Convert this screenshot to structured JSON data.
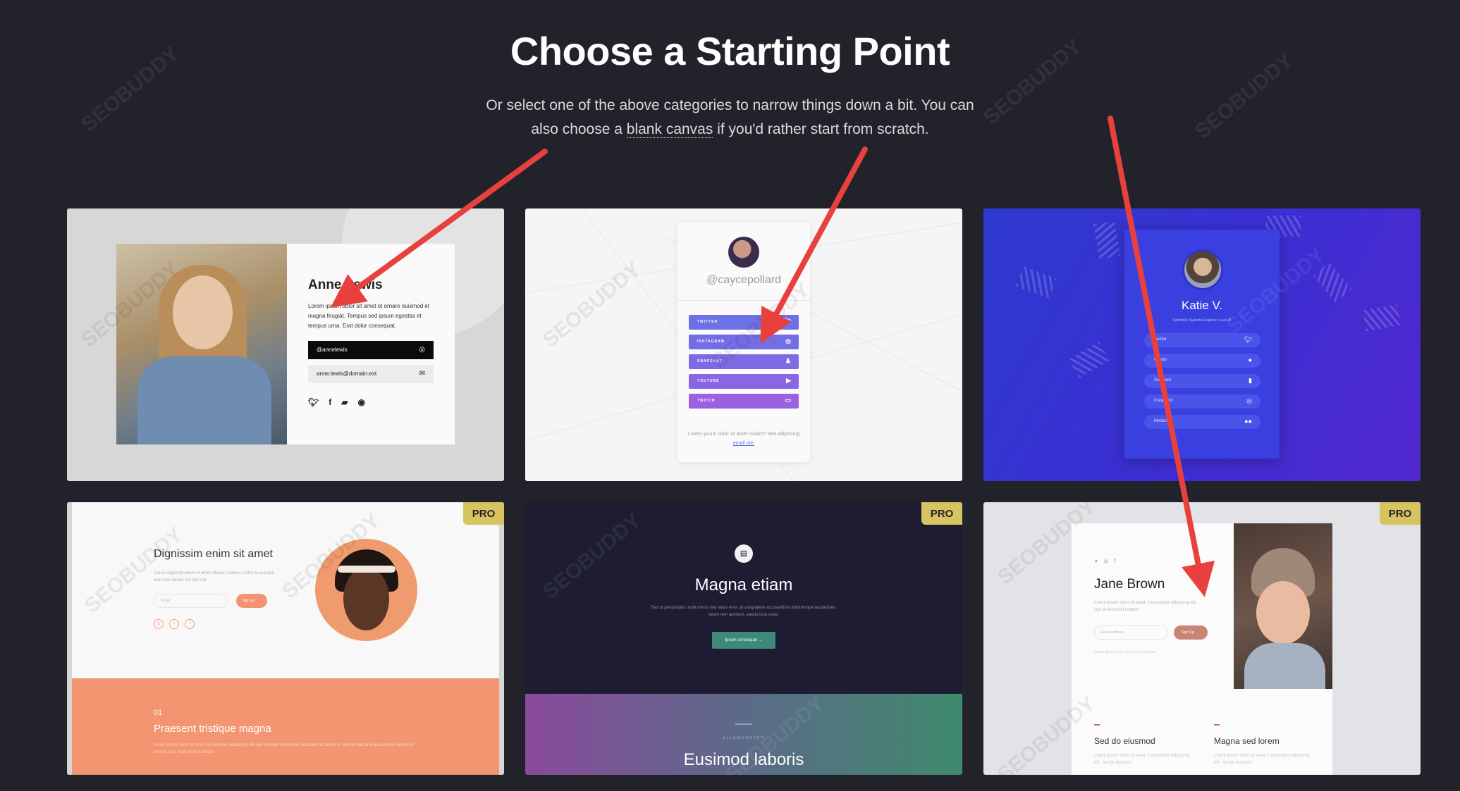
{
  "header": {
    "title": "Choose a Starting Point",
    "subtitle_line1": "Or select one of the above categories to narrow things down a bit. You can",
    "subtitle_line2_pre": "also choose a ",
    "subtitle_link": "blank canvas",
    "subtitle_line2_post": " if you'd rather start from scratch."
  },
  "cards": {
    "anne": {
      "name": "Anne Lewis",
      "desc": "Lorem ipsum dolor sit amet et ornare euismod et magna feugiat. Tempus sed ipsum egestas et tempus urna. Erat dolor consequat.",
      "handle": "@annelewis",
      "email": "anne.lewis@domain.ext"
    },
    "caycepollard": {
      "handle": "@caycepollard",
      "buttons": [
        {
          "label": "TWITTER",
          "icon": "twitter-icon",
          "color": "#6d70e6"
        },
        {
          "label": "INSTAGRAM",
          "icon": "instagram-icon",
          "color": "#756de4"
        },
        {
          "label": "SNAPCHAT",
          "icon": "snapchat-icon",
          "color": "#7f6ae4"
        },
        {
          "label": "YOUTUBE",
          "icon": "youtube-icon",
          "color": "#8b66e4"
        },
        {
          "label": "TWITCH",
          "icon": "twitch-icon",
          "color": "#9a62e2"
        }
      ],
      "foot_text": "Lorem ipsum dolor sit amet nullam? Sed adipiscing",
      "foot_link": "email me."
    },
    "katie": {
      "name": "Katie V.",
      "sub": "Optimistic Systems Engineer Level III",
      "buttons": [
        {
          "label": "Twitter",
          "icon": "twitter-icon"
        },
        {
          "label": "Github",
          "icon": "github-icon"
        },
        {
          "label": "Substack",
          "icon": "bookmark-icon"
        },
        {
          "label": "Instagram",
          "icon": "instagram-icon"
        },
        {
          "label": "Medium",
          "icon": "medium-icon"
        }
      ]
    },
    "dignissim": {
      "badge": "PRO",
      "title": "Dignissim enim sit amet",
      "desc": "Donec dignissim enim et amet efficitur sodales, tortor ex suscipit enim nec iaculis nisi elit erat",
      "email_placeholder": "Email",
      "signup": "Sign up",
      "num": "01",
      "bottom_title": "Praesent tristique magna",
      "bottom_desc": "Lorem ipsum dolor sit amet consectetur adipiscing elit sed do eiusmod tempor incididunt ut labore et dolore magna aliqua ut enim ad minim veniam quis nostrud exercitation"
    },
    "magna": {
      "badge": "PRO",
      "title": "Magna etiam",
      "desc": "Sed ut perspiciatis unde omnis iste natus error sit voluptatem accusantium doloremque laudantium, totam rem aperiam, eaque ipsa quae.",
      "button": "Ipsum consequat →",
      "kicker": "ULLAMCORPER",
      "bottom_title": "Eusimod laboris"
    },
    "jane": {
      "badge": "PRO",
      "name": "Jane Brown",
      "desc": "Lorem ipsum dolor sit amet, consectetur adipiscing elit, sed do eiusmod tempor.",
      "email_placeholder": "Email address",
      "signup": "Sign Up",
      "tiny": "Lorem ipsum dolor sit amet consectetur.",
      "feature1": "Sed do eiusmod",
      "feature2": "Magna sed lorem",
      "feature_desc": "Lorem ipsum dolor sit amet, consectetur adipiscing elit, sed do eiusmod."
    }
  },
  "watermark": "SEOBUDDY",
  "colors": {
    "background": "#22232a",
    "arrow": "#e8403d",
    "pro_badge": "#d8c361"
  }
}
